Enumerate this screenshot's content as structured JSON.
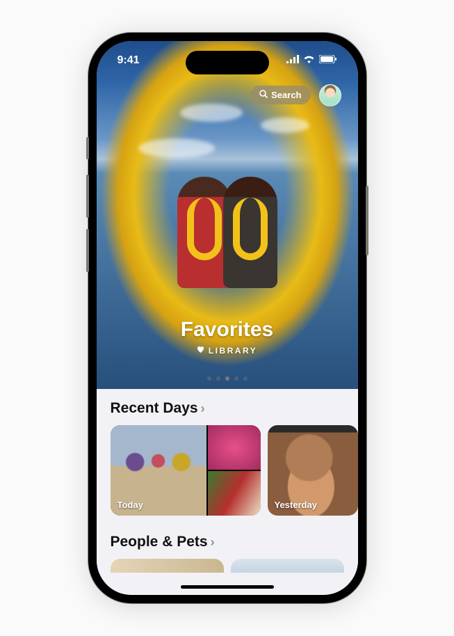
{
  "status": {
    "time": "9:41"
  },
  "header": {
    "search_label": "Search"
  },
  "hero": {
    "title": "Favorites",
    "subtitle": "LIBRARY",
    "page_dots": {
      "count": 5,
      "active_index": 2
    }
  },
  "sections": {
    "recent_days": {
      "title": "Recent Days",
      "cards": [
        {
          "label": "Today"
        },
        {
          "label": "Yesterday"
        }
      ]
    },
    "people_pets": {
      "title": "People & Pets"
    }
  }
}
